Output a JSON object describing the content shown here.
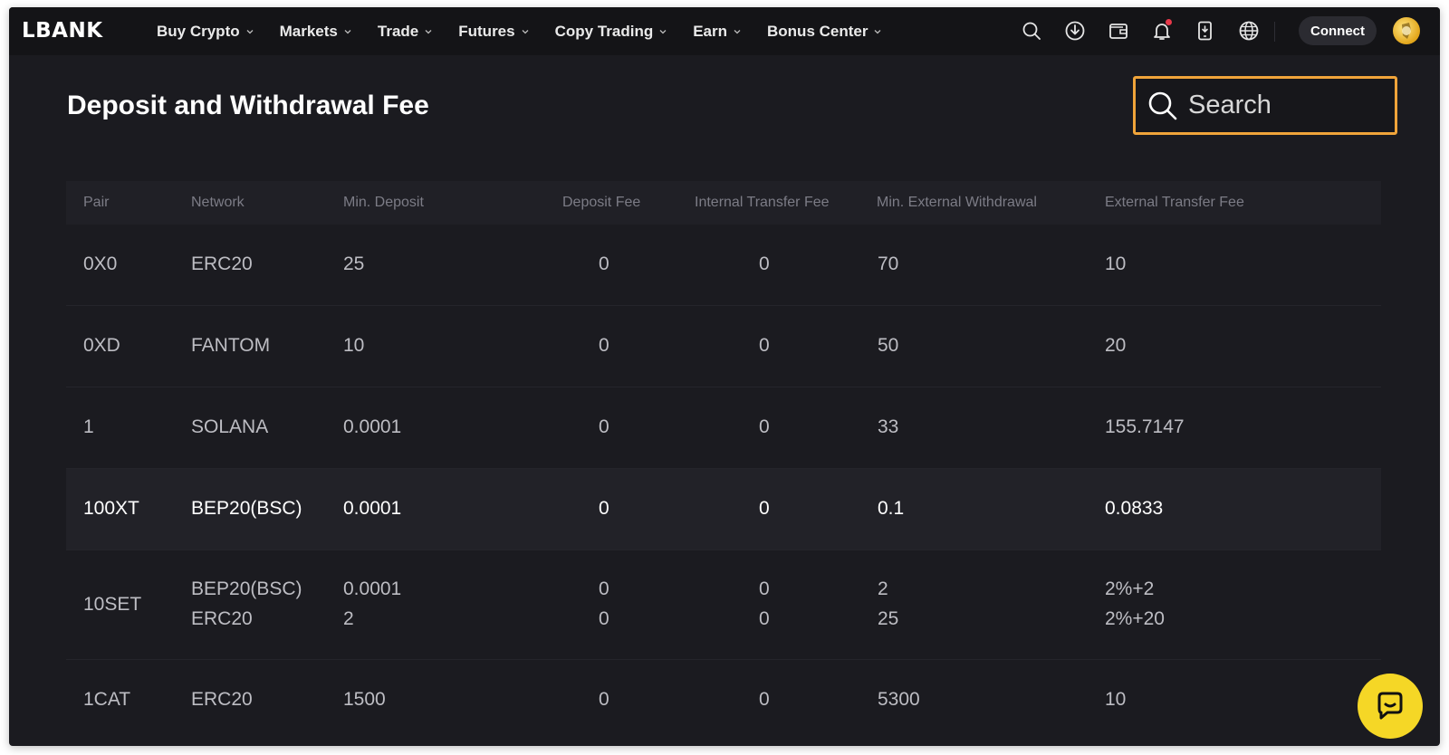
{
  "brand": {
    "logo": "LBANK"
  },
  "nav": [
    {
      "label": "Buy Crypto"
    },
    {
      "label": "Markets"
    },
    {
      "label": "Trade"
    },
    {
      "label": "Futures"
    },
    {
      "label": "Copy Trading"
    },
    {
      "label": "Earn"
    },
    {
      "label": "Bonus Center"
    }
  ],
  "header_icons": [
    "search-icon",
    "download-icon",
    "wallet-icon",
    "bell-icon",
    "phone-icon",
    "globe-icon"
  ],
  "connect_label": "Connect",
  "page": {
    "title": "Deposit and Withdrawal Fee"
  },
  "search": {
    "placeholder": "Search"
  },
  "table": {
    "columns": [
      "Pair",
      "Network",
      "Min. Deposit",
      "Deposit Fee",
      "Internal Transfer Fee",
      "Min. External Withdrawal",
      "External Transfer Fee"
    ],
    "rows": [
      {
        "pair": "0X0",
        "entries": [
          {
            "network": "ERC20",
            "min_deposit": "25",
            "deposit_fee": "0",
            "internal_fee": "0",
            "min_withdrawal": "70",
            "external_fee": "10"
          }
        ]
      },
      {
        "pair": "0XD",
        "entries": [
          {
            "network": "FANTOM",
            "min_deposit": "10",
            "deposit_fee": "0",
            "internal_fee": "0",
            "min_withdrawal": "50",
            "external_fee": "20"
          }
        ]
      },
      {
        "pair": "1",
        "entries": [
          {
            "network": "SOLANA",
            "min_deposit": "0.0001",
            "deposit_fee": "0",
            "internal_fee": "0",
            "min_withdrawal": "33",
            "external_fee": "155.7147"
          }
        ]
      },
      {
        "pair": "100XT",
        "highlighted": true,
        "entries": [
          {
            "network": "BEP20(BSC)",
            "min_deposit": "0.0001",
            "deposit_fee": "0",
            "internal_fee": "0",
            "min_withdrawal": "0.1",
            "external_fee": "0.0833"
          }
        ]
      },
      {
        "pair": "10SET",
        "entries": [
          {
            "network": "BEP20(BSC)",
            "min_deposit": "0.0001",
            "deposit_fee": "0",
            "internal_fee": "0",
            "min_withdrawal": "2",
            "external_fee": "2%+2"
          },
          {
            "network": "ERC20",
            "min_deposit": "2",
            "deposit_fee": "0",
            "internal_fee": "0",
            "min_withdrawal": "25",
            "external_fee": "2%+20"
          }
        ]
      },
      {
        "pair": "1CAT",
        "entries": [
          {
            "network": "ERC20",
            "min_deposit": "1500",
            "deposit_fee": "0",
            "internal_fee": "0",
            "min_withdrawal": "5300",
            "external_fee": "10"
          }
        ]
      }
    ]
  },
  "colors": {
    "accent": "#f0a43a",
    "chat": "#f5d726",
    "background": "#1b1b20"
  }
}
